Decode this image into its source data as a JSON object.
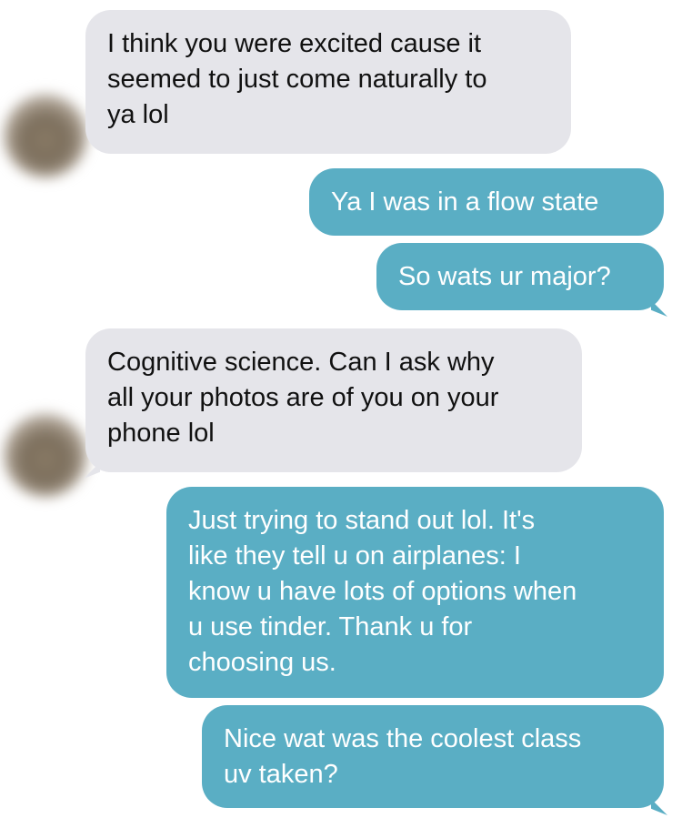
{
  "messages": [
    {
      "direction": "incoming",
      "text": "I think you were excited cause it\nseemed to just come naturally to\nya lol"
    },
    {
      "direction": "outgoing",
      "text": "Ya I was in a flow state"
    },
    {
      "direction": "outgoing",
      "text": "So wats ur major?"
    },
    {
      "direction": "incoming",
      "text": "Cognitive science. Can I ask why\nall your photos are of you on your\nphone lol"
    },
    {
      "direction": "outgoing",
      "text": "Just trying to stand out lol. It's\nlike they tell u on airplanes: I\nknow u have lots of options when\nu use tinder. Thank u for\nchoosing us."
    },
    {
      "direction": "outgoing",
      "text": "Nice wat was the coolest class\nuv taken?"
    }
  ],
  "colors": {
    "incoming_bubble": "#e5e5ea",
    "outgoing_bubble": "#5aaec4",
    "incoming_text": "#111111",
    "outgoing_text": "#ffffff"
  }
}
